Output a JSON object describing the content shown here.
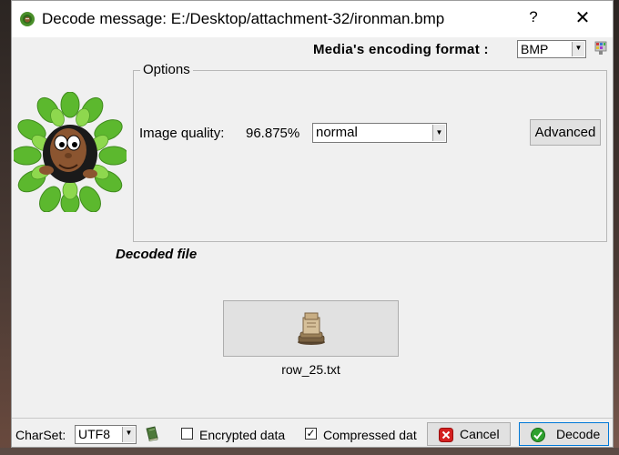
{
  "window": {
    "title": "Decode message: E:/Desktop/attachment-32/ironman.bmp",
    "help": "?",
    "close": "✕"
  },
  "encoding": {
    "label": "Media's encoding format :",
    "selected": "BMP"
  },
  "options": {
    "legend": "Options",
    "image_quality_label": "Image quality:",
    "image_quality_value": "96.875%",
    "quality_selected": "normal",
    "advanced_button": "Advanced"
  },
  "decoded": {
    "label": "Decoded file",
    "file_name": "row_25.txt"
  },
  "footer": {
    "charset_label": "CharSet:",
    "charset_selected": "UTF8",
    "encrypted_label": "Encrypted data",
    "encrypted_checked": false,
    "compressed_label": "Compressed dat",
    "compressed_checked": true,
    "compressed_check_mark": "✓",
    "cancel_button": "Cancel",
    "decode_button": "Decode"
  },
  "icons": {
    "title_icon": "app-icon",
    "tool_icon": "palette-tool-icon",
    "mascot": "mascot-in-leaves",
    "file_icon": "archive-file-icon",
    "book_icon": "charset-book-icon",
    "cancel_icon": "cancel-x-icon",
    "decode_icon": "check-icon"
  },
  "colors": {
    "cancel_icon": "#d42020",
    "decode_icon": "#2ea12e",
    "default_button_border": "#0078d7"
  }
}
